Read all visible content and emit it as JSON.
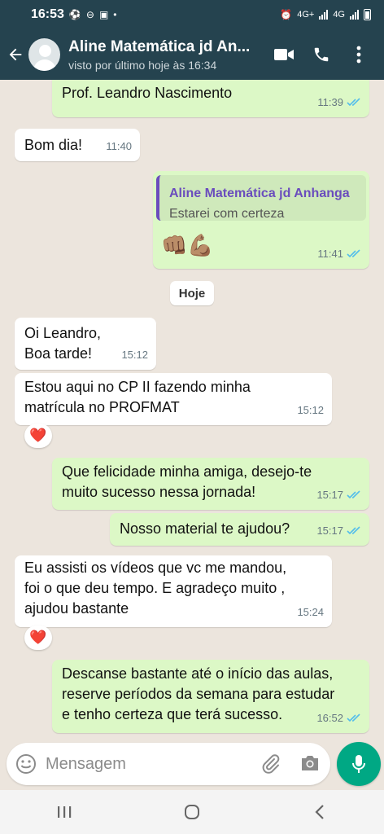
{
  "status_bar": {
    "time": "16:53",
    "network_label_1": "4G+",
    "network_label_2": "4G"
  },
  "header": {
    "contact_name": "Aline Matemática jd An...",
    "last_seen": "visto por último hoje às 16:34"
  },
  "messages": [
    {
      "id": "m1",
      "dir": "out",
      "text": "Prof. Leandro Nascimento",
      "time": "11:39",
      "read": true
    },
    {
      "id": "m2",
      "dir": "in",
      "text": "Bom dia!",
      "time": "11:40"
    },
    {
      "id": "m3",
      "dir": "out",
      "quote_name": "Aline Matemática jd Anhanga",
      "quote_text": "Estarei com certeza",
      "text": "👊🏽💪🏽",
      "time": "11:41",
      "read": true
    },
    {
      "id": "m4",
      "dir": "in",
      "text": "Oi Leandro,\nBoa tarde!",
      "time": "15:12"
    },
    {
      "id": "m5",
      "dir": "in",
      "text": "Estou aqui no CP II fazendo minha\nmatrícula no PROFMAT",
      "time": "15:12",
      "reaction": "❤️"
    },
    {
      "id": "m6",
      "dir": "out",
      "text": "Que felicidade minha amiga, desejo-te\nmuito sucesso nessa jornada!",
      "time": "15:17",
      "read": true
    },
    {
      "id": "m7",
      "dir": "out",
      "text": "Nosso material te ajudou?",
      "time": "15:17",
      "read": true
    },
    {
      "id": "m8",
      "dir": "in",
      "text": "Eu assisti os vídeos que vc me mandou,\nfoi o que deu tempo. E agradeço muito ,\najudou bastante",
      "time": "15:24",
      "reaction": "❤️"
    },
    {
      "id": "m9",
      "dir": "out",
      "text": "Descanse bastante até o início das aulas,\nreserve períodos da semana para estudar\ne tenho certeza que terá sucesso.",
      "time": "16:52",
      "read": true
    }
  ],
  "date_chip": "Hoje",
  "input": {
    "placeholder": "Mensagem"
  },
  "icons": {
    "back": "arrow-left-icon",
    "video": "video-call-icon",
    "phone": "phone-icon",
    "menu": "more-vert-icon",
    "emoji": "emoji-icon",
    "attach": "paperclip-icon",
    "camera": "camera-icon",
    "mic": "microphone-icon"
  },
  "colors": {
    "header": "#25434f",
    "outgoing_bubble": "#dcf8c6",
    "incoming_bubble": "#ffffff",
    "read_ticks": "#53bdeb",
    "mic_button": "#00a884",
    "quote_accent": "#6a4cbd"
  }
}
